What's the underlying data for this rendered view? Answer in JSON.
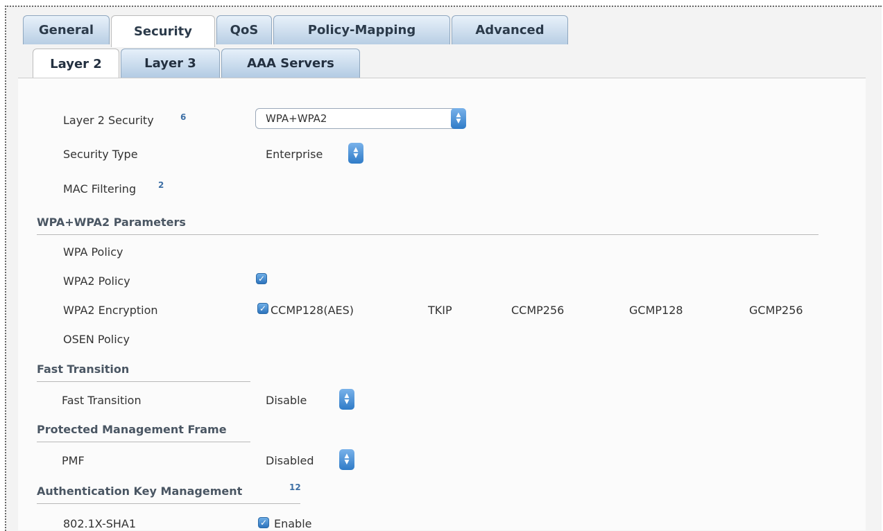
{
  "tabs": [
    "General",
    "Security",
    "QoS",
    "Policy-Mapping",
    "Advanced"
  ],
  "subtabs": [
    "Layer 2",
    "Layer 3",
    "AAA Servers"
  ],
  "layer2": {
    "security_label": "Layer 2 Security",
    "security_value": "WPA+WPA2",
    "security_help": "6",
    "type_label": "Security Type",
    "type_value": "Enterprise",
    "mac_label": "MAC Filtering",
    "mac_help": "2"
  },
  "wpa": {
    "heading": "WPA+WPA2 Parameters",
    "policy_label": "WPA Policy",
    "policy_checked": false,
    "wpa2_policy_label": "WPA2 Policy",
    "wpa2_policy_checked": true,
    "enc_label": "WPA2 Encryption",
    "enc_options": [
      "CCMP128(AES)",
      "TKIP",
      "CCMP256",
      "GCMP128",
      "GCMP256"
    ],
    "enc_checked": [
      true,
      false,
      false,
      false,
      false
    ],
    "osen_label": "OSEN Policy",
    "osen_checked": false
  },
  "fast_transition": {
    "heading": "Fast Transition",
    "label": "Fast Transition",
    "value": "Disable"
  },
  "pmf": {
    "heading": "Protected Management Frame",
    "label": "PMF",
    "value": "Disabled"
  },
  "akm": {
    "heading": "Authentication Key Management",
    "help": "12",
    "item_label": "802.1X-SHA1",
    "item_value": "Enable",
    "item_checked": true
  },
  "colors": {
    "accent": "#2f7bc7",
    "tab_bg": "#c9dbee",
    "section_text": "#4a5663"
  }
}
